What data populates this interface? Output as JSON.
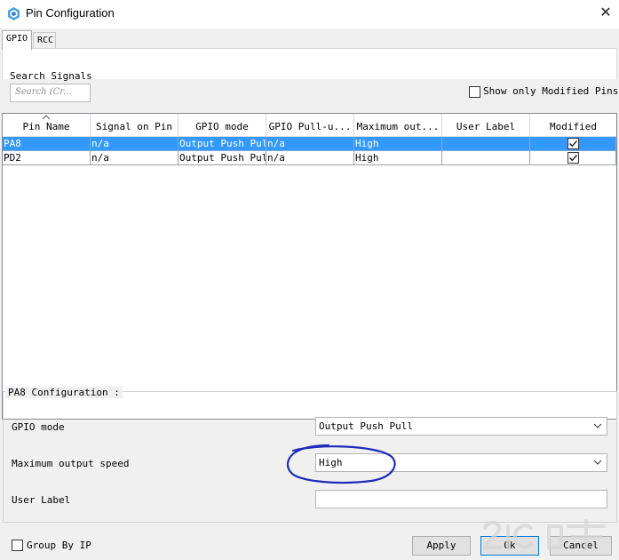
{
  "window": {
    "title": "Pin Configuration",
    "close_glyph": "✕",
    "icon": "app-icon"
  },
  "tabs": [
    {
      "label": "GPIO",
      "active": true
    },
    {
      "label": "RCC",
      "active": false
    }
  ],
  "search": {
    "label": "Search Signals",
    "placeholder": "Search (Cr..."
  },
  "modified_filter": {
    "label": "Show only Modified Pins",
    "checked": false
  },
  "table": {
    "columns": [
      "Pin Name",
      "Signal on Pin",
      "GPIO mode",
      "GPIO Pull-u...",
      "Maximum out...",
      "User Label",
      "Modified"
    ],
    "sorted_column": "Pin Name",
    "rows": [
      {
        "pin": "PA8",
        "signal": "n/a",
        "mode": "Output Push Pull",
        "pull": "n/a",
        "speed": "High",
        "label": "",
        "modified": true,
        "selected": true
      },
      {
        "pin": "PD2",
        "signal": "n/a",
        "mode": "Output Push Pull",
        "pull": "n/a",
        "speed": "High",
        "label": "",
        "modified": true,
        "selected": false
      }
    ]
  },
  "config": {
    "title": "PA8 Configuration :",
    "gpio_mode": {
      "label": "GPIO mode",
      "value": "Output Push Pull"
    },
    "speed": {
      "label": "Maximum output speed",
      "value": "High"
    },
    "user_label": {
      "label": "User Label",
      "value": ""
    }
  },
  "footer": {
    "group_by_ip": {
      "label": "Group By IP",
      "checked": false
    },
    "apply": "Apply",
    "ok": "Ok",
    "cancel": "Cancel"
  },
  "colors": {
    "selection": "#3399ff",
    "annotation": "#1f2bb8",
    "accent_border": "#0078d7"
  }
}
